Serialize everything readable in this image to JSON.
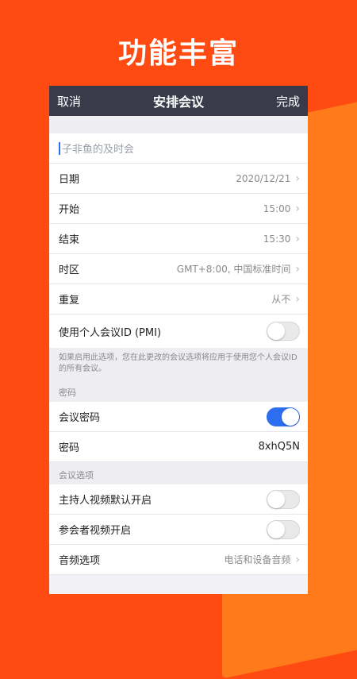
{
  "headline": "功能丰富",
  "nav": {
    "cancel": "取消",
    "title": "安排会议",
    "done": "完成"
  },
  "topic": {
    "placeholder": "子非鱼的及时会"
  },
  "rows": {
    "date": {
      "label": "日期",
      "value": "2020/12/21"
    },
    "start": {
      "label": "开始",
      "value": "15:00"
    },
    "end": {
      "label": "结束",
      "value": "15:30"
    },
    "timezone": {
      "label": "时区",
      "value": "GMT+8:00, 中国标准时间"
    },
    "repeat": {
      "label": "重复",
      "value": "从不"
    },
    "pmi": {
      "label": "使用个人会议ID (PMI)",
      "on": false
    }
  },
  "pmi_note": "如果启用此选项，您在此更改的会议选项将应用于使用您个人会议ID的所有会议。",
  "password_section": {
    "label": "密码",
    "meeting_password": {
      "label": "会议密码",
      "on": true
    },
    "password": {
      "label": "密码",
      "value": "8xhQ5N"
    }
  },
  "options_section": {
    "label": "会议选项",
    "host_video": {
      "label": "主持人视频默认开启",
      "on": false
    },
    "participant_video": {
      "label": "参会者视频开启",
      "on": false
    },
    "audio": {
      "label": "音频选项",
      "value": "电话和设备音频"
    }
  },
  "colors": {
    "background": "#ff4b12",
    "accent": "#ff7a1a",
    "toggle_on": "#2d6ef0",
    "nav": "#393a4a"
  }
}
